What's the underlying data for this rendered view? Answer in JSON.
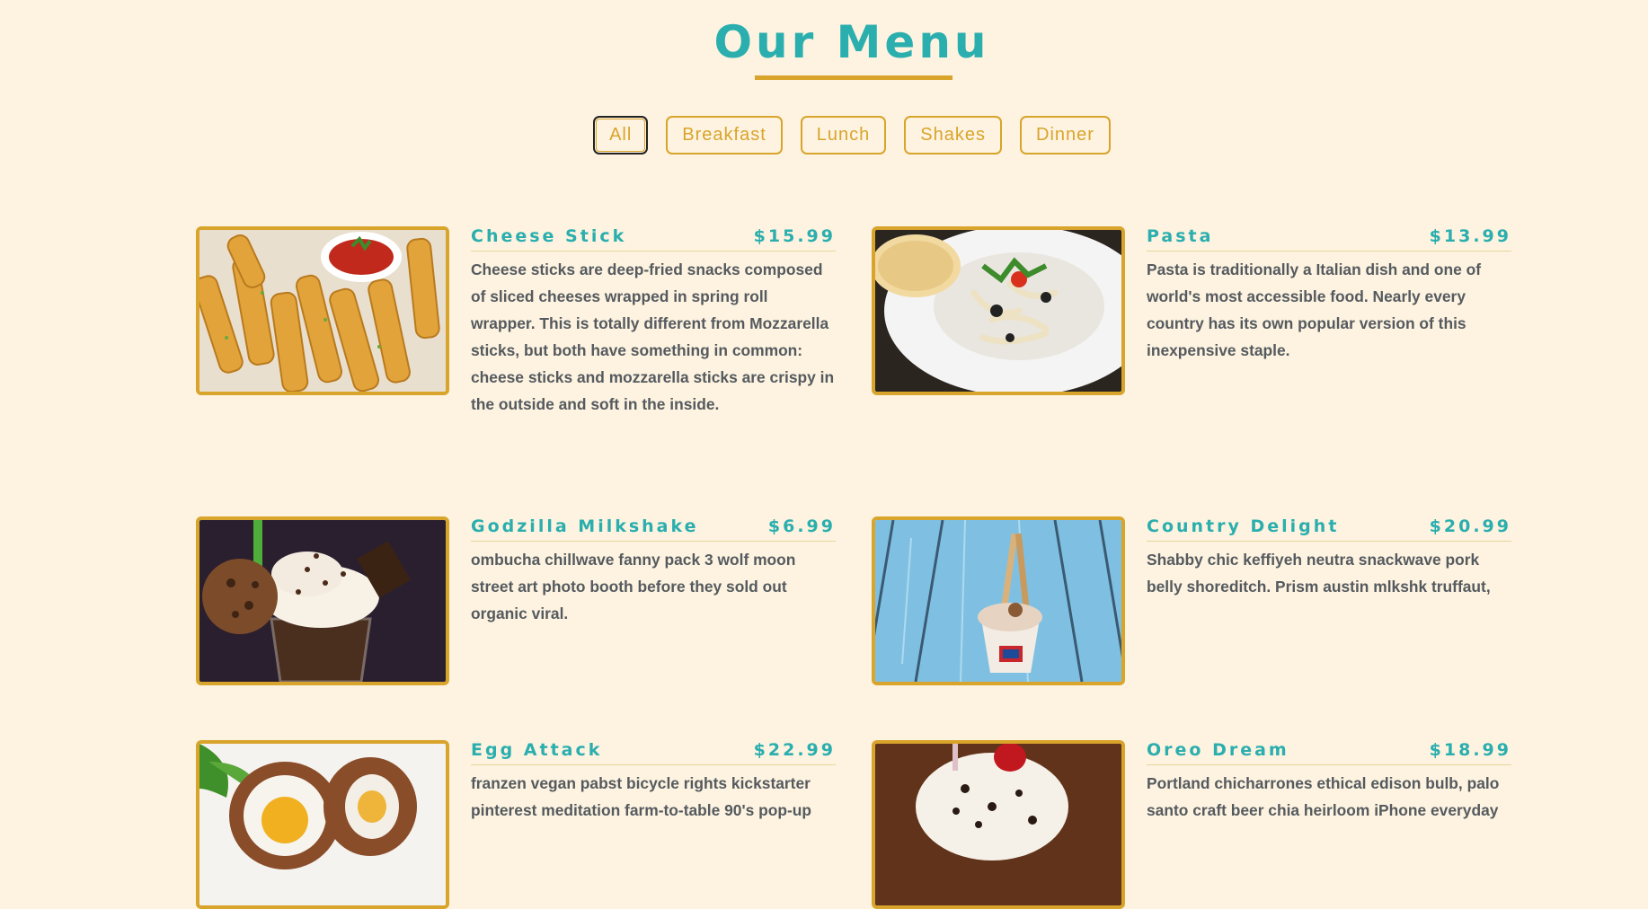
{
  "page": {
    "title": "Our Menu"
  },
  "filters": [
    "All",
    "Breakfast",
    "Lunch",
    "Shakes",
    "Dinner"
  ],
  "items": [
    {
      "name": "Cheese Stick",
      "price": "$15.99",
      "description": "Cheese sticks are deep-fried snacks composed of sliced cheeses wrapped in spring roll wrapper. This is totally different from Mozzarella sticks, but both have something in common: cheese sticks and mozzarella sticks are crispy in the outside and soft in the inside."
    },
    {
      "name": "Pasta",
      "price": "$13.99",
      "description": "Pasta is traditionally a Italian dish and one of world's most accessible food. Nearly every country has its own popular version of this inexpensive staple."
    },
    {
      "name": "Godzilla Milkshake",
      "price": "$6.99",
      "description": "ombucha chillwave fanny pack 3 wolf moon street art photo booth before they sold out organic viral."
    },
    {
      "name": "Country Delight",
      "price": "$20.99",
      "description": "Shabby chic keffiyeh neutra snackwave pork belly shoreditch. Prism austin mlkshk truffaut,"
    },
    {
      "name": "Egg Attack",
      "price": "$22.99",
      "description": "franzen vegan pabst bicycle rights kickstarter pinterest meditation farm-to-table 90's pop-up"
    },
    {
      "name": "Oreo Dream",
      "price": "$18.99",
      "description": "Portland chicharrones ethical edison bulb, palo santo craft beer chia heirloom iPhone everyday"
    }
  ],
  "colors": {
    "background": "#fdf3e0",
    "accent_teal": "#2aaeae",
    "accent_gold": "#d9a42b",
    "text": "#555a5f"
  }
}
